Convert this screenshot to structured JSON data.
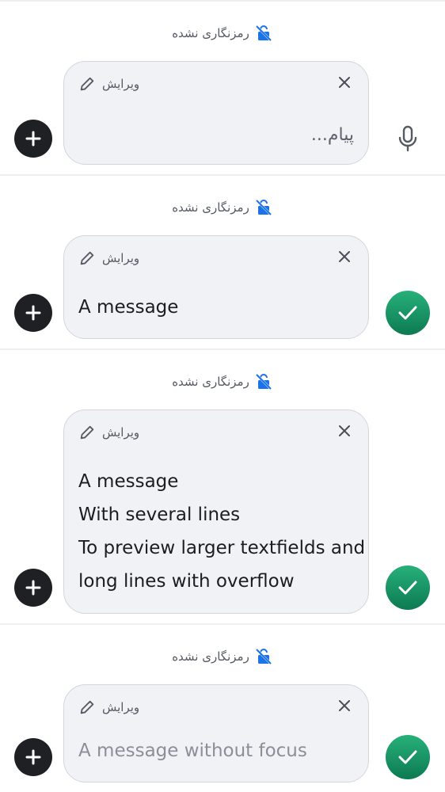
{
  "encryption_label": "رمزنگاری نشده",
  "edit_label": "ویرایش",
  "composers": [
    {
      "state": "empty",
      "placeholder": "پیام..."
    },
    {
      "state": "filled",
      "message": "A message"
    },
    {
      "state": "multiline",
      "lines": [
        "A message",
        "With several lines",
        "To preview larger textfields and",
        "long lines with overflow"
      ]
    },
    {
      "state": "unfocused",
      "message": "A message without focus"
    }
  ],
  "colors": {
    "plus_button": "#1f2024",
    "send_button": "#159160",
    "bubble_bg": "#f1f2f6",
    "lock_icon": "#1a73e8"
  },
  "icons": [
    "lock-open-icon",
    "pencil-icon",
    "close-icon",
    "plus-icon",
    "mic-icon",
    "check-icon"
  ]
}
